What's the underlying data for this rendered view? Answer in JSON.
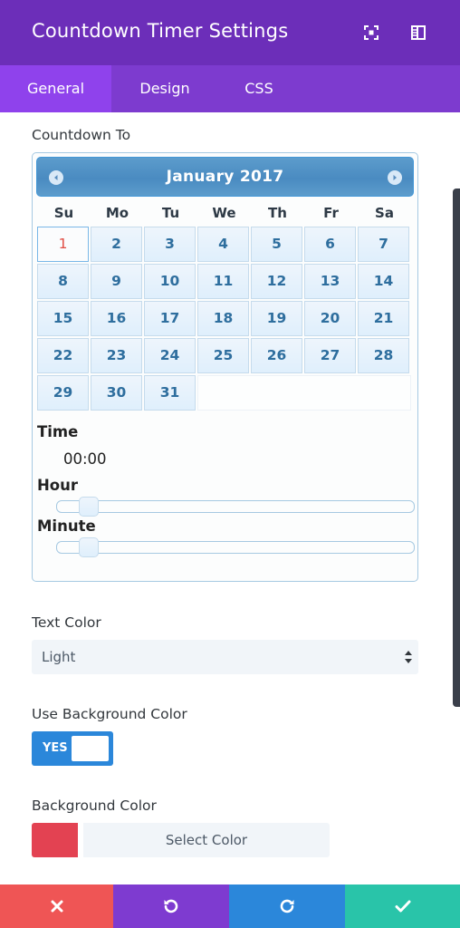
{
  "header": {
    "title": "Countdown Timer Settings",
    "icons": [
      "fullscreen-icon",
      "sidebar-layout-icon"
    ]
  },
  "tabs": [
    {
      "label": "General",
      "active": true
    },
    {
      "label": "Design",
      "active": false
    },
    {
      "label": "CSS",
      "active": false
    }
  ],
  "countdown": {
    "label": "Countdown To",
    "datepicker": {
      "month_label": "January 2017",
      "weekdays": [
        "Su",
        "Mo",
        "Tu",
        "We",
        "Th",
        "Fr",
        "Sa"
      ],
      "weeks": [
        [
          "1",
          "2",
          "3",
          "4",
          "5",
          "6",
          "7"
        ],
        [
          "8",
          "9",
          "10",
          "11",
          "12",
          "13",
          "14"
        ],
        [
          "15",
          "16",
          "17",
          "18",
          "19",
          "20",
          "21"
        ],
        [
          "22",
          "23",
          "24",
          "25",
          "26",
          "27",
          "28"
        ],
        [
          "29",
          "30",
          "31"
        ]
      ],
      "highlighted_day": "1"
    },
    "time": {
      "time_label": "Time",
      "value": "00:00",
      "hour_label": "Hour",
      "minute_label": "Minute",
      "hour_level": 0,
      "minute_level": 0
    }
  },
  "text_color": {
    "label": "Text Color",
    "selected": "Light"
  },
  "use_background": {
    "label": "Use Background Color",
    "toggle_label": "YES",
    "enabled": true
  },
  "background_color": {
    "label": "Background Color",
    "button_label": "Select Color",
    "swatch": "#e34252"
  },
  "colors": {
    "header": "#6c2eb9",
    "tabs": "#7d3bcf",
    "tab_active": "#8f42ec",
    "cancel": "#ef5555",
    "undo": "#7e3bd0",
    "redo": "#2b87da",
    "save": "#29c4a9"
  },
  "footer": {
    "icons": [
      "close-icon",
      "undo-icon",
      "redo-icon",
      "check-icon"
    ]
  }
}
